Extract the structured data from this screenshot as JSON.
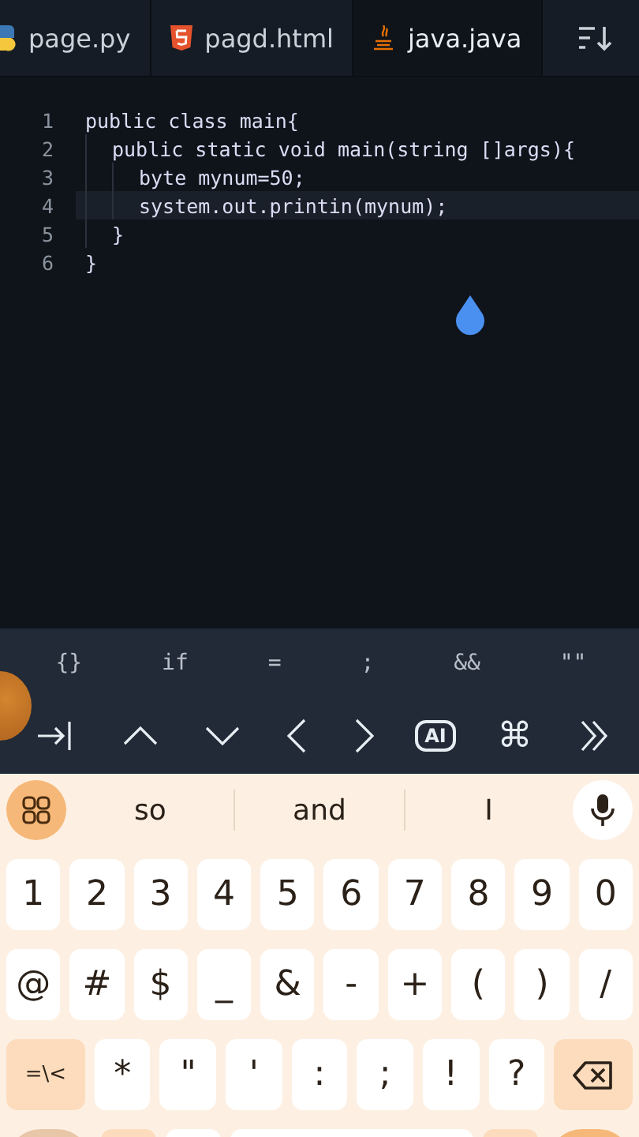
{
  "tabs": [
    {
      "label": "page.py",
      "selected": false
    },
    {
      "label": "pagd.html",
      "selected": false
    },
    {
      "label": "java.java",
      "selected": true
    }
  ],
  "editor": {
    "lines": [
      {
        "number": "1",
        "text": "public class main{",
        "current": false,
        "children": [
          {
            "number": "2",
            "text": "public static void main(string []args){",
            "current": false,
            "children": [
              {
                "number": "3",
                "text": "byte mynum=50;",
                "current": false
              },
              {
                "number": "4",
                "text": "system.out.printin(mynum);",
                "current": true
              }
            ]
          },
          {
            "number": "5",
            "text": "}",
            "current": false
          }
        ]
      },
      {
        "number": "6",
        "text": "}",
        "current": false
      }
    ]
  },
  "symbol_bar": [
    "{}",
    "if",
    "=",
    ";",
    "&&",
    "\"\""
  ],
  "nav_bar": [
    {
      "kind": "tab"
    },
    {
      "kind": "up"
    },
    {
      "kind": "down"
    },
    {
      "kind": "left"
    },
    {
      "kind": "right"
    },
    {
      "kind": "ai",
      "label": "AI"
    },
    {
      "kind": "command",
      "label": "⌘"
    },
    {
      "kind": "more"
    }
  ],
  "keyboard": {
    "suggestions": [
      "so",
      "and",
      "I"
    ],
    "rows": [
      [
        {
          "kind": "char",
          "label": "1"
        },
        {
          "kind": "char",
          "label": "2"
        },
        {
          "kind": "char",
          "label": "3"
        },
        {
          "kind": "char",
          "label": "4"
        },
        {
          "kind": "char",
          "label": "5"
        },
        {
          "kind": "char",
          "label": "6"
        },
        {
          "kind": "char",
          "label": "7"
        },
        {
          "kind": "char",
          "label": "8"
        },
        {
          "kind": "char",
          "label": "9"
        },
        {
          "kind": "char",
          "label": "0"
        }
      ],
      [
        {
          "kind": "char",
          "label": "@"
        },
        {
          "kind": "char",
          "label": "#"
        },
        {
          "kind": "char",
          "label": "$"
        },
        {
          "kind": "char",
          "label": "_"
        },
        {
          "kind": "char",
          "label": "&"
        },
        {
          "kind": "char",
          "label": "-"
        },
        {
          "kind": "char",
          "label": "+"
        },
        {
          "kind": "char",
          "label": "("
        },
        {
          "kind": "char",
          "label": ")"
        },
        {
          "kind": "char",
          "label": "/"
        }
      ],
      [
        {
          "kind": "function",
          "label": "=\\<"
        },
        {
          "kind": "char",
          "label": "*"
        },
        {
          "kind": "char",
          "label": "\""
        },
        {
          "kind": "char",
          "label": "'"
        },
        {
          "kind": "char",
          "label": ":"
        },
        {
          "kind": "char",
          "label": ";"
        },
        {
          "kind": "char",
          "label": "!"
        },
        {
          "kind": "char",
          "label": "?"
        },
        {
          "kind": "backspace"
        }
      ]
    ]
  }
}
